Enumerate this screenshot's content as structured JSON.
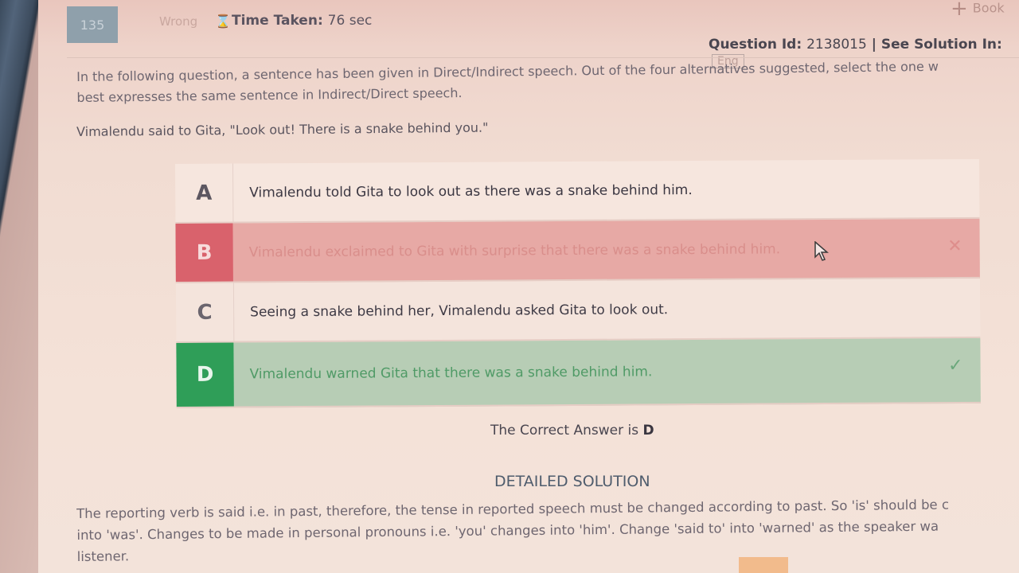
{
  "header": {
    "question_number": "135",
    "status": "Wrong",
    "hourglass_icon": "hourglass-icon",
    "time_label": "Time Taken:",
    "time_value": "76 sec",
    "bookmark_label": "Book",
    "question_id_label": "Question Id:",
    "question_id": "2138015",
    "solution_label": "| See Solution In:",
    "language": "Eng"
  },
  "question": {
    "instruction_line1": "In the following question, a sentence has been given in Direct/Indirect speech. Out of the four alternatives suggested, select the one w",
    "instruction_line2": "best expresses the same sentence in Indirect/Direct speech.",
    "sentence": "Vimalendu said to Gita, \"Look out! There is a snake behind you.\""
  },
  "options": [
    {
      "letter": "A",
      "text": "Vimalendu told Gita to look out as there was a snake behind him."
    },
    {
      "letter": "B",
      "text": "Vimalendu exclaimed to Gita with surprise that there was a snake behind him.",
      "mark": "✕"
    },
    {
      "letter": "C",
      "text": "Seeing a snake behind her, Vimalendu asked Gita to look out."
    },
    {
      "letter": "D",
      "text": "Vimalendu warned Gita that there was a snake behind him.",
      "mark": "✓"
    }
  ],
  "result": {
    "prefix": "The Correct Answer is",
    "answer": "D"
  },
  "solution": {
    "title": "DETAILED SOLUTION",
    "line1": "The reporting verb is said i.e. in past, therefore, the tense in reported speech must be changed according to past. So 'is' should be c",
    "line2": "into 'was'. Changes to be made in personal pronouns i.e. 'you' changes into 'him'. Change 'said to' into 'warned' as the speaker wa",
    "line3": "listener."
  },
  "colors": {
    "wrong": "#d9626c",
    "correct": "#2f9e58"
  }
}
